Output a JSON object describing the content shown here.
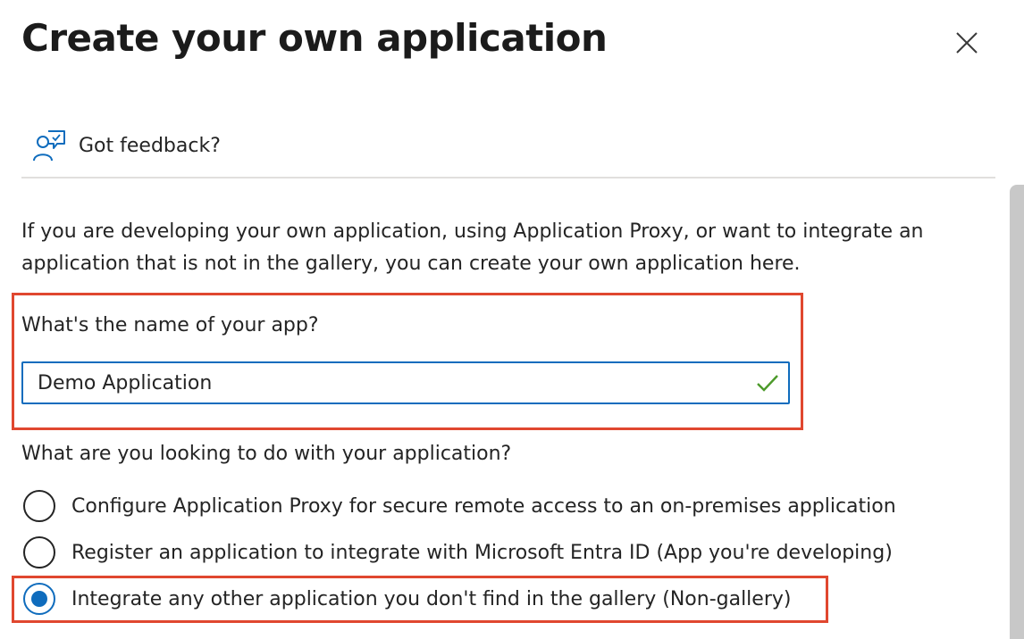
{
  "dialog": {
    "title": "Create your own application",
    "close_icon": "close-icon"
  },
  "feedback": {
    "icon": "feedback-person-icon",
    "label": "Got feedback?"
  },
  "intro_text": "If you are developing your own application, using Application Proxy, or want to integrate an application that is not in the gallery, you can create your own application here.",
  "name_field": {
    "label": "What's the name of your app?",
    "value": "Demo Application",
    "valid_icon": "checkmark-icon"
  },
  "purpose": {
    "question": "What are you looking to do with your application?",
    "options": [
      {
        "label": "Configure Application Proxy for secure remote access to an on-premises application",
        "selected": false
      },
      {
        "label": "Register an application to integrate with Microsoft Entra ID (App you're developing)",
        "selected": false
      },
      {
        "label": "Integrate any other application you don't find in the gallery (Non-gallery)",
        "selected": true
      }
    ]
  },
  "colors": {
    "accent": "#0f6cbd",
    "highlight": "#e0472f",
    "valid": "#4c9a2a"
  }
}
